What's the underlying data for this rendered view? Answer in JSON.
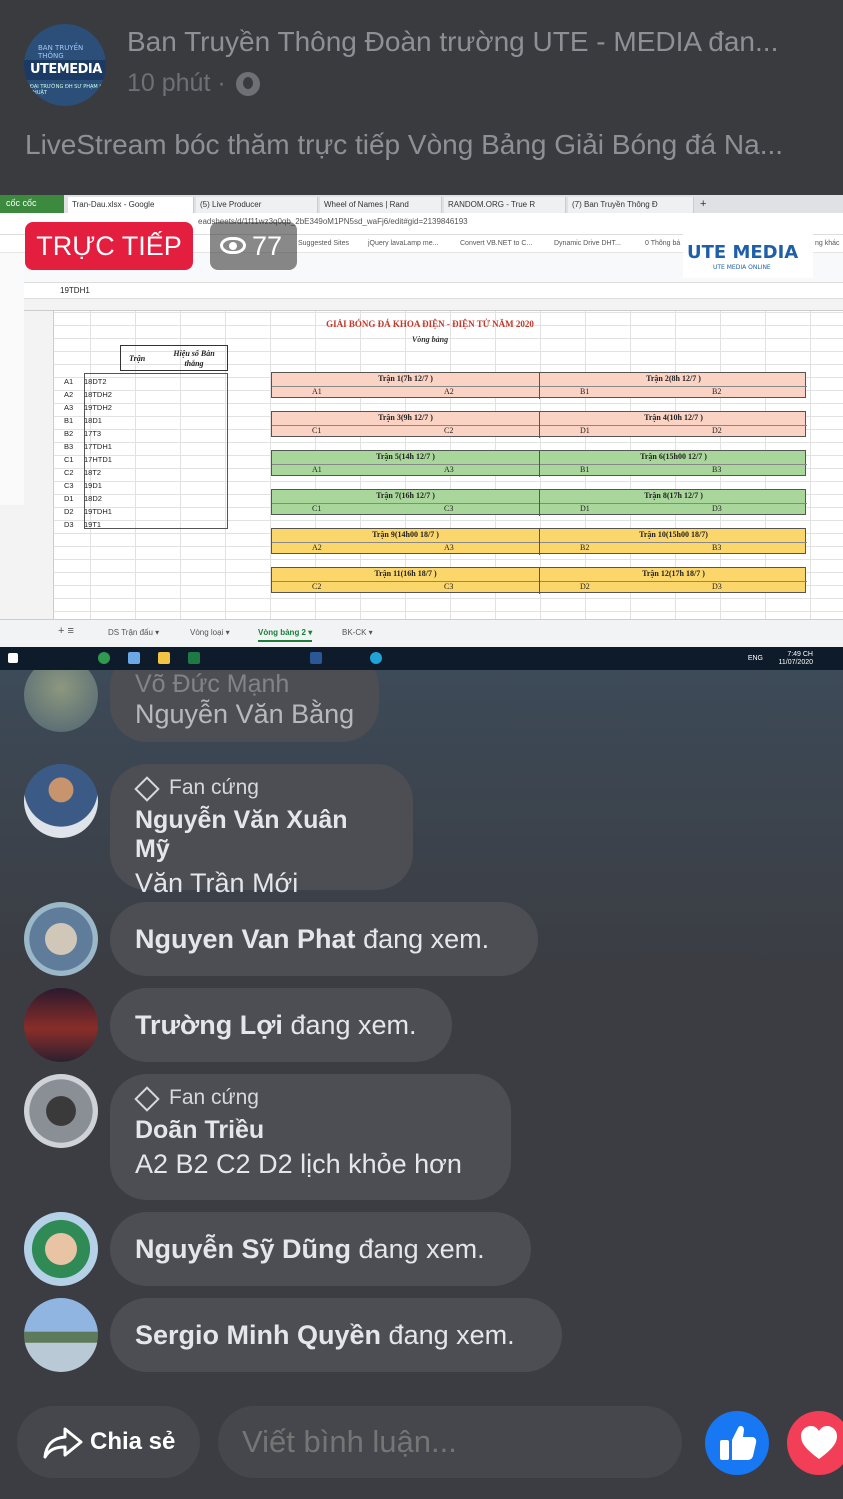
{
  "header": {
    "page_name": "Ban Truyền Thông Đoàn trường UTE - MEDIA đan...",
    "time": "10 phút ·",
    "post_text": "LiveStream bóc thăm trực tiếp Vòng Bảng Giải Bóng đá Na..."
  },
  "logo": {
    "top": "BAN TRUYỀN THÔNG",
    "main": "UTEMEDIA",
    "bottom": "ĐẠI TRƯỜNG ĐH SƯ PHẠM KỸ THUẬT"
  },
  "video": {
    "live_label": "TRỰC TIẾP",
    "viewers": "77",
    "browser": {
      "coccoc": "cốc cốc",
      "tabs": [
        "Tran-Dau.xlsx - Google",
        "(5) Live Producer",
        "Wheel of Names | Rand",
        "RANDOM.ORG - True R",
        "(7) Ban Truyền Thông Đ",
        "+"
      ],
      "url": "eadsheets/d/1f11wz3q0qb_2bE349oM1PN5sd_waFj6/edit#gid=2139846193",
      "bookmarks": [
        "Suggested Sites",
        "jQuery lavaLamp me...",
        "Convert VB.NET to C...",
        "Dynamic Drive DHT...",
        "0 Thông bá",
        "ng khác"
      ]
    },
    "ute_overlay": {
      "main": "UTE MEDIA",
      "sub": "UTE MEDIA ONLINE"
    },
    "sheet": {
      "cell_ref": "19TDH1",
      "title": "GIẢI BÓNG ĐÁ KHOA ĐIỆN - ĐIỆN TỬ NĂM 2020",
      "subtitle": "Vòng bảng",
      "col_tran": "Trận",
      "col_hieuso": "Hiệu số Bàn thắng",
      "teams": [
        {
          "group": "A1",
          "team": "18DT2"
        },
        {
          "group": "A2",
          "team": "18TDH2"
        },
        {
          "group": "A3",
          "team": "19TDH2"
        },
        {
          "group": "B1",
          "team": "18D1"
        },
        {
          "group": "B2",
          "team": "17T3"
        },
        {
          "group": "B3",
          "team": "17TDH1"
        },
        {
          "group": "C1",
          "team": "17HTD1"
        },
        {
          "group": "C2",
          "team": "18T2"
        },
        {
          "group": "C3",
          "team": "19D1"
        },
        {
          "group": "D1",
          "team": "18D2"
        },
        {
          "group": "D2",
          "team": "19TDH1"
        },
        {
          "group": "D3",
          "team": "19T1"
        }
      ],
      "matches": [
        {
          "title": "Trận 1(7h 12/7 )",
          "a": "A1",
          "b": "A2",
          "color": "#fbd3c4"
        },
        {
          "title": "Trận 2(8h 12/7 )",
          "a": "B1",
          "b": "B2",
          "color": "#fbd3c4"
        },
        {
          "title": "Trận 3(9h 12/7 )",
          "a": "C1",
          "b": "C2",
          "color": "#fbd3c4"
        },
        {
          "title": "Trận 4(10h 12/7 )",
          "a": "D1",
          "b": "D2",
          "color": "#fbd3c4"
        },
        {
          "title": "Trận 5(14h 12/7 )",
          "a": "A1",
          "b": "A3",
          "color": "#a9d79b"
        },
        {
          "title": "Trận 6(15h00 12/7 )",
          "a": "B1",
          "b": "B3",
          "color": "#a9d79b"
        },
        {
          "title": "Trận 7(16h 12/7 )",
          "a": "C1",
          "b": "C3",
          "color": "#a9d79b"
        },
        {
          "title": "Trận 8(17h 12/7 )",
          "a": "D1",
          "b": "D3",
          "color": "#a9d79b"
        },
        {
          "title": "Trận 9(14h00 18/7 )",
          "a": "A2",
          "b": "A3",
          "color": "#fbd66a"
        },
        {
          "title": "Trận 10(15h00 18/7)",
          "a": "B2",
          "b": "B3",
          "color": "#fbd66a"
        },
        {
          "title": "Trận 11(16h 18/7 )",
          "a": "C2",
          "b": "C3",
          "color": "#fbd66a"
        },
        {
          "title": "Trận 12(17h 18/7 )",
          "a": "D2",
          "b": "D3",
          "color": "#fbd66a"
        }
      ],
      "sheet_tabs": [
        "DS Trận đấu ▾",
        "Vòng loại ▾",
        "Vòng bảng 2 ▾",
        "BK-CK ▾"
      ],
      "active_tab": "Vòng bảng 2 ▾"
    },
    "taskbar": {
      "lang": "ENG",
      "time": "7:49 CH",
      "date": "11/07/2020"
    }
  },
  "comments": [
    {
      "faded_name": "Võ Đức Mạnh",
      "text": "Nguyễn Văn Bằng"
    },
    {
      "badge": "Fan cứng",
      "name": "Nguyễn Văn Xuân Mỹ",
      "text": "Văn Trần Mới"
    },
    {
      "name": "Nguyen Van Phat",
      "text": "đang xem."
    },
    {
      "name": "Trường Lợi",
      "text": "đang xem."
    },
    {
      "badge": "Fan cứng",
      "name": "Doãn Triều",
      "text": "A2 B2 C2 D2 lịch khỏe hơn"
    },
    {
      "name": "Nguyễn Sỹ Dũng",
      "text": "đang xem."
    },
    {
      "name": "Sergio Minh Quyền",
      "text": "đang xem."
    }
  ],
  "footer": {
    "share_label": "Chia sẻ",
    "comment_placeholder": "Viết bình luận..."
  },
  "colors": {
    "live": "#e41e3f",
    "like": "#1877f2",
    "love": "#f33e58"
  }
}
